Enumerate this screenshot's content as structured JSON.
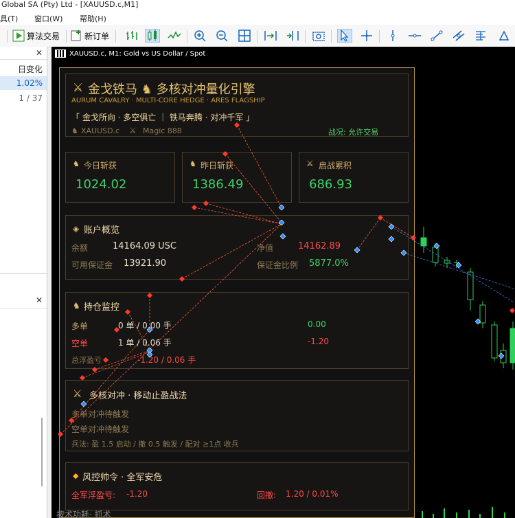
{
  "window": {
    "title": "Global SA (Pty) Ltd - [XAUUSD.c,M1]"
  },
  "menu": [
    "具(T)",
    "窗口(W)",
    "帮助(H)"
  ],
  "toolbar": {
    "algo_trading": "算法交易",
    "new_order": "新订单"
  },
  "left_panel": {
    "header": "日变化",
    "value": "1.02%",
    "page": "1 / 37"
  },
  "chart": {
    "header": "XAUUSD.c, M1:  Gold vs US Dollar / Spot"
  },
  "ea": {
    "title": "金戈铁马 ♞ 多核对冲量化引擎",
    "subtitle": "AURUM CAVALRY · MULTI-CORE HEDGE · ARES FLAGSHIP",
    "motto": "「 金戈所向 · 多空俱亡 ｜ 铁马奔腾 · 对冲千军 」",
    "symbol": "XAUUSD.c",
    "magic": "Magic 888",
    "status": "战况: 允许交易",
    "today_label": "今日斩获",
    "today_value": "1024.02",
    "yesterday_label": "昨日斩获",
    "yesterday_value": "1386.49",
    "total_label": "启战累积",
    "total_value": "686.93",
    "account_title": "账户概览",
    "balance_label": "余额",
    "balance_value": "14164.09 USC",
    "equity_label": "净值",
    "equity_value": "14162.89",
    "free_margin_label": "可用保证金",
    "free_margin_value": "13921.90",
    "margin_level_label": "保证金比例",
    "margin_level_value": "5877.0%",
    "positions_title": "持仓监控",
    "long_label": "多单",
    "long_value": "0 单 / 0.00 手",
    "long_pl": "0.00",
    "short_label": "空单",
    "short_value": "1 单 / 0.06 手",
    "short_pl": "-1.20",
    "total_float_label": "总浮盈亏",
    "total_float_value": "-1.20  /  0.06 手",
    "strategy_title": "多核对冲 · 移动止盈战法",
    "strategy_long": "多单对冲待触发",
    "strategy_short": "空单对冲待触发",
    "strategy_rules": "兵法: 盈 1.5 启动 / 撤 0.5 触发 / 配对 ≥1点 收兵",
    "risk_title": "风控帅令 · 全军安危",
    "risk_float_label": "全军浮盈亏:",
    "risk_float_value": "-1.20",
    "risk_dd_label": "回撤:",
    "risk_dd_value": "1.20 / 0.01%"
  },
  "bottom_cutoff": "按术功耗·  抓术"
}
